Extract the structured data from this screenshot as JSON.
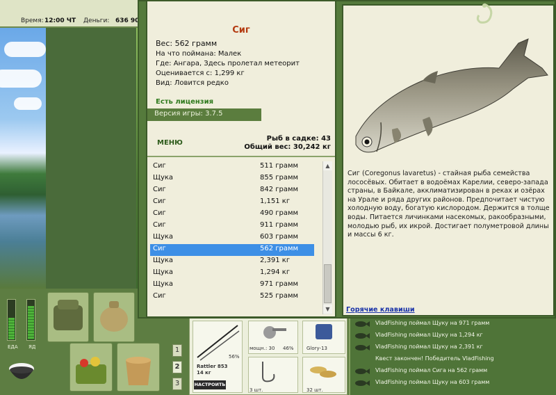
{
  "topbar": {
    "time_label": "Время:",
    "time_value": "12:00 ЧТ",
    "money_label": "Деньги:",
    "money_value": "636 90"
  },
  "gauges": {
    "food_label": "ЕДА",
    "poison_label": "ЯД",
    "food_level": 0.55,
    "poison_level": 0.85
  },
  "numbuttons": [
    "1",
    "2",
    "3"
  ],
  "tackle": {
    "rod_name": "Rattler 853",
    "rod_weight": "14 кг",
    "setup_button": "НАСТРОИТЬ",
    "rod_percent": "56%",
    "reel_label": "мощн.: 30",
    "reel_percent": "46%",
    "line_label": "Glory-13",
    "hook_count": "3 шт.",
    "bait_count": "32 шт."
  },
  "chat": [
    "VladFishing поймал Щуку на 971 грамм",
    "VladFishing поймал Щуку на 1,294 кг",
    "VladFishing поймал Щуку на 2,391 кг",
    "Квест закончен! Победитель VladFishing",
    "VladFishing поймал Сига на 562 грамм",
    "VladFishing поймал Щуку на 603 грамм"
  ],
  "popup": {
    "fish_title": "Сиг",
    "weight": "Вес: 562 грамм",
    "info": [
      "На что поймана: Малек",
      "Где: Ангара, Здесь пролетал метеорит",
      "Оценивается с: 1,299 кг",
      "Вид: Ловится редко"
    ],
    "license": "Есть лицензия",
    "version": "Версия игры: 3.7.5",
    "menu_button": "МЕНЮ",
    "keep_count": "Рыб в садке: 43",
    "total_weight": "Общий вес: 30,242 кг",
    "catch_list": [
      {
        "name": "Сиг",
        "weight": "511 грамм"
      },
      {
        "name": "Щука",
        "weight": "855 грамм"
      },
      {
        "name": "Сиг",
        "weight": "842 грамм"
      },
      {
        "name": "Сиг",
        "weight": "1,151 кг"
      },
      {
        "name": "Сиг",
        "weight": "490 грамм"
      },
      {
        "name": "Сиг",
        "weight": "911 грамм"
      },
      {
        "name": "Щука",
        "weight": "603 грамм"
      },
      {
        "name": "Сиг",
        "weight": "562 грамм"
      },
      {
        "name": "Щука",
        "weight": "2,391 кг"
      },
      {
        "name": "Щука",
        "weight": "1,294 кг"
      },
      {
        "name": "Щука",
        "weight": "971 грамм"
      },
      {
        "name": "Сиг",
        "weight": "525 грамм"
      }
    ],
    "selected_index": 7,
    "description": "Сиг (Coregonus lavaretus) - стайная рыба семейства лососёвых. Обитает в водоёмах Карелии, северо-запада страны, в Байкале, акклиматизирован в реках и озёрах на Урале и ряда других районов. Предпочитает чистую холодную воду, богатую кислородом. Держится в толще воды. Питается личинками насекомых, ракообразными, молодью рыб, их икрой. Достигает полуметровой длины и массы 6 кг.",
    "hotkeys_link": "Горячие клавиши"
  },
  "colors": {
    "accent_green": "#557a3c",
    "panel_bg": "#f0eedc",
    "title_red": "#b43a10",
    "selection_blue": "#3d8fe6",
    "link_blue": "#1a33a8"
  }
}
